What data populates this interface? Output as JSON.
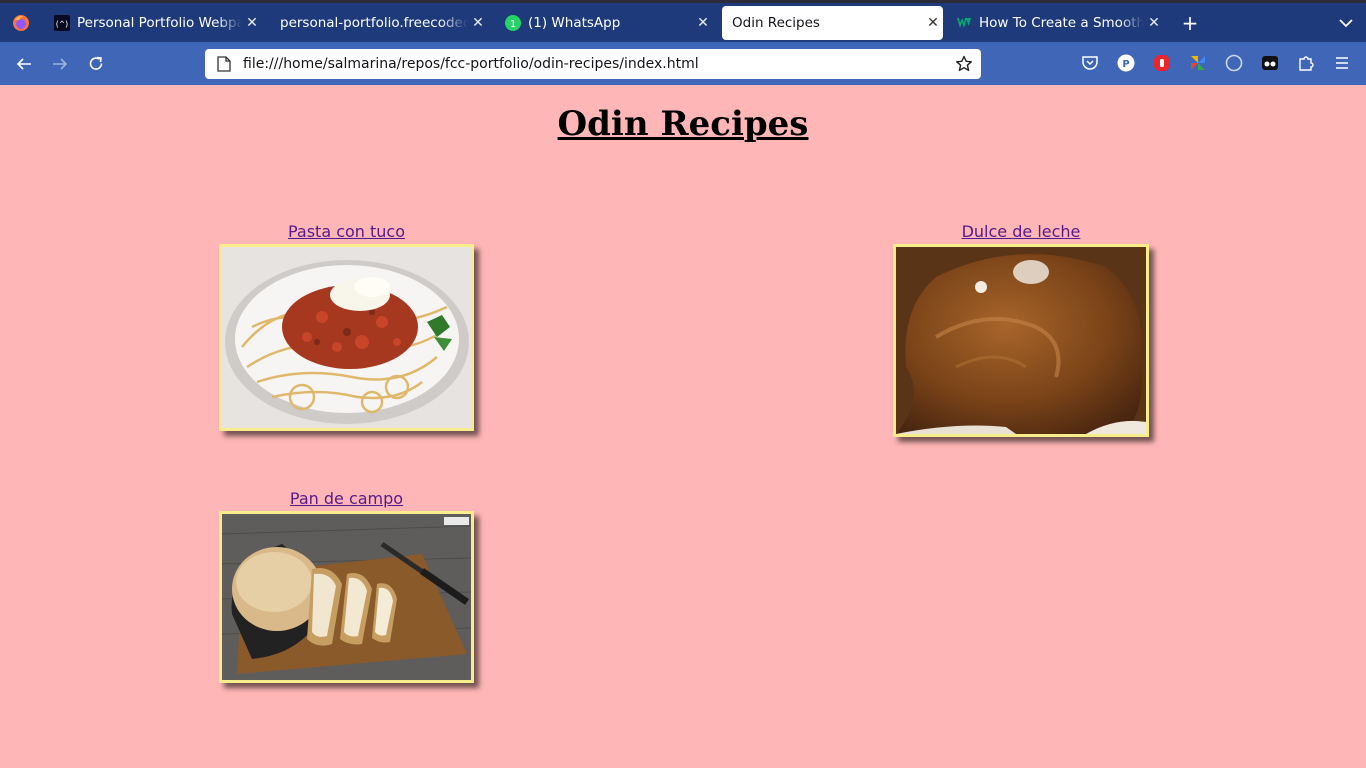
{
  "browser": {
    "tabs": [
      {
        "title": "Personal Portfolio Webpage",
        "icon": "freecodecamp-icon",
        "active": false
      },
      {
        "title": "personal-portfolio.freecodecamp",
        "icon": "none",
        "active": false
      },
      {
        "title": "(1) WhatsApp",
        "icon": "whatsapp-icon",
        "active": false
      },
      {
        "title": "Odin Recipes",
        "icon": "none",
        "active": true
      },
      {
        "title": "How To Create a Smooth Scroll",
        "icon": "w3schools-icon",
        "active": false
      }
    ],
    "whatsapp_badge": "1",
    "url": "file:///home/salmarina/repos/fcc-portfolio/odin-recipes/index.html",
    "extension_p_label": "P"
  },
  "page": {
    "title": "Odin Recipes",
    "recipes": [
      {
        "name": "Pasta con tuco",
        "image": "pasta-image"
      },
      {
        "name": "Dulce de leche",
        "image": "dulce-de-leche-image"
      },
      {
        "name": "Pan de campo",
        "image": "bread-image"
      }
    ]
  },
  "colors": {
    "page_background": "#ffb6b6",
    "tabbar": "#1e3a7a",
    "toolbar": "#3f66b7",
    "image_border": "#f7ed8a",
    "link": "#551a8b"
  }
}
